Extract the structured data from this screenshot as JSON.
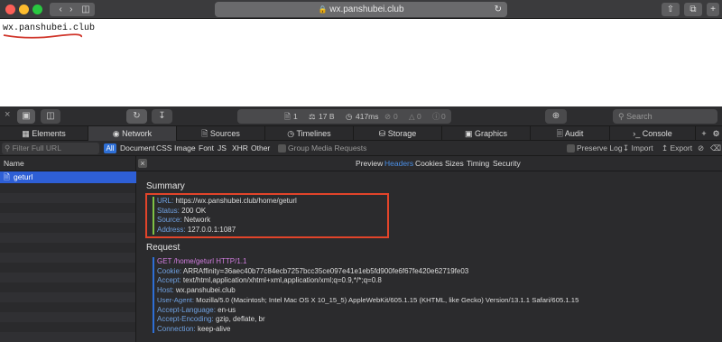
{
  "browser": {
    "url": "wx.panshubei.club",
    "colors": {
      "close": "#fc5f57",
      "minimize": "#fdbc2e",
      "zoom": "#29c840"
    }
  },
  "page": {
    "text": "wx.panshubei.club"
  },
  "devtools": {
    "summary": {
      "files": "1",
      "size": "17 B",
      "time": "417ms",
      "errors": "0",
      "warnings": "0",
      "logs": "0"
    },
    "search_placeholder": "Search",
    "tabs": [
      {
        "label": "Elements",
        "icon": "elements-icon"
      },
      {
        "label": "Network",
        "icon": "network-icon"
      },
      {
        "label": "Sources",
        "icon": "sources-icon"
      },
      {
        "label": "Timelines",
        "icon": "timelines-icon"
      },
      {
        "label": "Storage",
        "icon": "storage-icon"
      },
      {
        "label": "Graphics",
        "icon": "graphics-icon"
      },
      {
        "label": "Audit",
        "icon": "audit-icon"
      },
      {
        "label": "Console",
        "icon": "console-icon"
      }
    ],
    "filter": {
      "placeholder": "Filter Full URL",
      "types": [
        "All",
        "Document",
        "CSS",
        "Image",
        "Font",
        "JS",
        "XHR",
        "Other"
      ],
      "group_media": "Group Media Requests",
      "preserve_log": "Preserve Log",
      "import": "Import",
      "export": "Export"
    },
    "name_header": "Name",
    "request_name": "geturl",
    "subtabs": [
      "Preview",
      "Headers",
      "Cookies",
      "Sizes",
      "Timing",
      "Security"
    ],
    "summary_section": {
      "title": "Summary",
      "rows": [
        {
          "key": "URL:",
          "value": "https://wx.panshubei.club/home/geturl"
        },
        {
          "key": "Status:",
          "value": "200 OK"
        },
        {
          "key": "Source:",
          "value": "Network"
        },
        {
          "key": "Address:",
          "value": "127.0.0.1:1087"
        }
      ]
    },
    "request_section": {
      "title": "Request",
      "request_line": "GET /home/geturl HTTP/1.1",
      "headers": [
        {
          "key": "Cookie:",
          "value": "ARRAffinity=36aec40b77c84ecb7257bcc35ce097e41e1eb5fd900fe6f67fe420e62719fe03"
        },
        {
          "key": "Accept:",
          "value": "text/html,application/xhtml+xml,application/xml;q=0.9,*/*;q=0.8"
        },
        {
          "key": "Host:",
          "value": "wx.panshubei.club"
        },
        {
          "key": "User-Agent:",
          "value": "Mozilla/5.0 (Macintosh; Intel Mac OS X 10_15_5) AppleWebKit/605.1.15 (KHTML, like Gecko) Version/13.1.1 Safari/605.1.15"
        },
        {
          "key": "Accept-Language:",
          "value": "en-us"
        },
        {
          "key": "Accept-Encoding:",
          "value": "gzip, deflate, br"
        },
        {
          "key": "Connection:",
          "value": "keep-alive"
        }
      ]
    }
  }
}
